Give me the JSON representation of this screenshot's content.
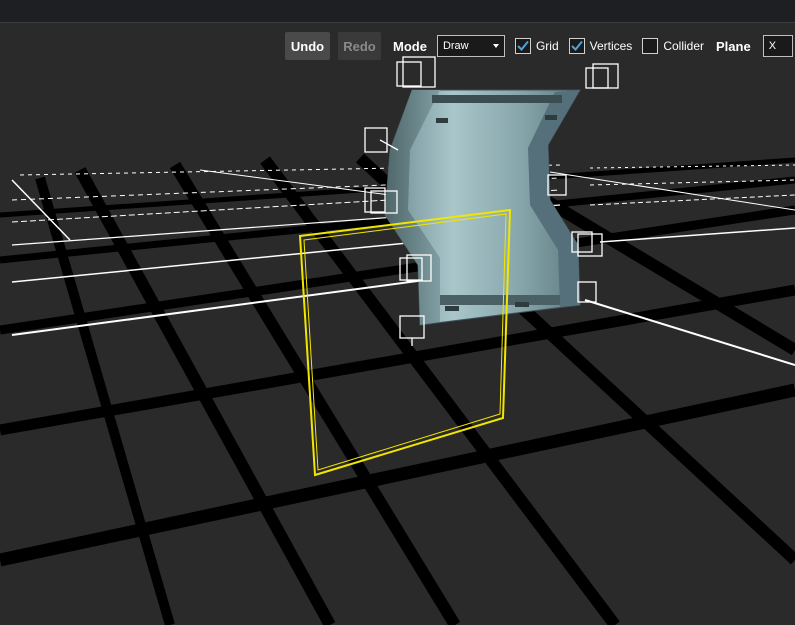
{
  "toolbar": {
    "undo_label": "Undo",
    "redo_label": "Redo",
    "mode_label": "Mode",
    "mode_value": "Draw",
    "grid_label": "Grid",
    "grid_checked": true,
    "vertices_label": "Vertices",
    "vertices_checked": true,
    "collider_label": "Collider",
    "collider_checked": false,
    "plane_label": "Plane",
    "plane_value": "X"
  },
  "colors": {
    "viewport_bg": "#2a2a2a",
    "grid_lines": "#000000",
    "world_axis_lines": "#ffffff",
    "selection_outline": "#f2e600",
    "wall_texture": "#8fb0b5",
    "checkbox_accent": "#4aa3df"
  },
  "icons": {
    "checkmark": "check-icon",
    "dropdown": "caret-down-icon",
    "vertex_handle": "cube-wireframe-icon"
  }
}
